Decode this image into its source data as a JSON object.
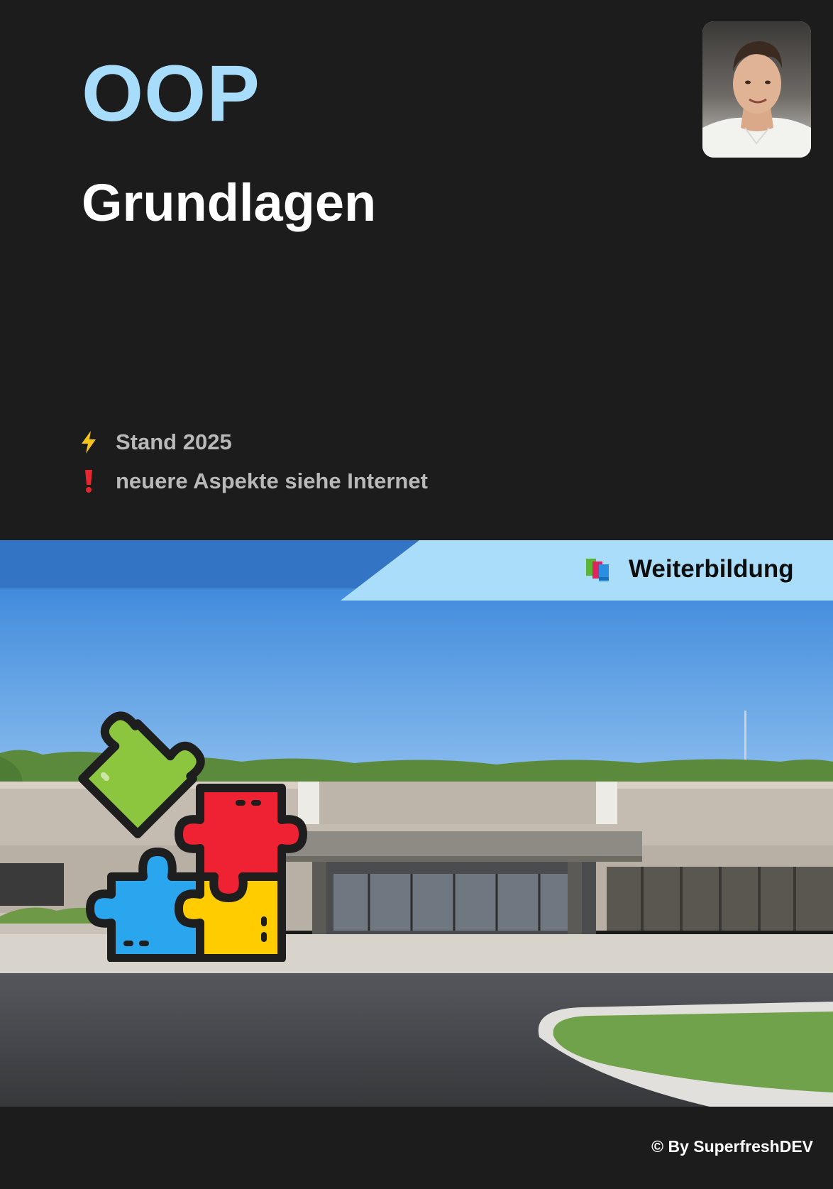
{
  "title": "OOP",
  "subtitle": "Grundlagen",
  "info": [
    {
      "icon": "lightning-icon",
      "text": "Stand 2025"
    },
    {
      "icon": "exclamation-icon",
      "text": "neuere Aspekte siehe Internet"
    }
  ],
  "tag": {
    "icon": "books-icon",
    "label": "Weiterbildung"
  },
  "footer": {
    "text": "© By SuperfreshDEV"
  },
  "colors": {
    "background": "#1c1c1c",
    "title": "#a8dcfb",
    "subtitle": "#ffffff",
    "info_text": "#b9b9b9",
    "banner_dark": "#3474c4",
    "banner_light": "#a9ddfa",
    "puzzle": [
      "#8cc63f",
      "#ee2233",
      "#2aa6ee",
      "#ffcc00"
    ]
  }
}
